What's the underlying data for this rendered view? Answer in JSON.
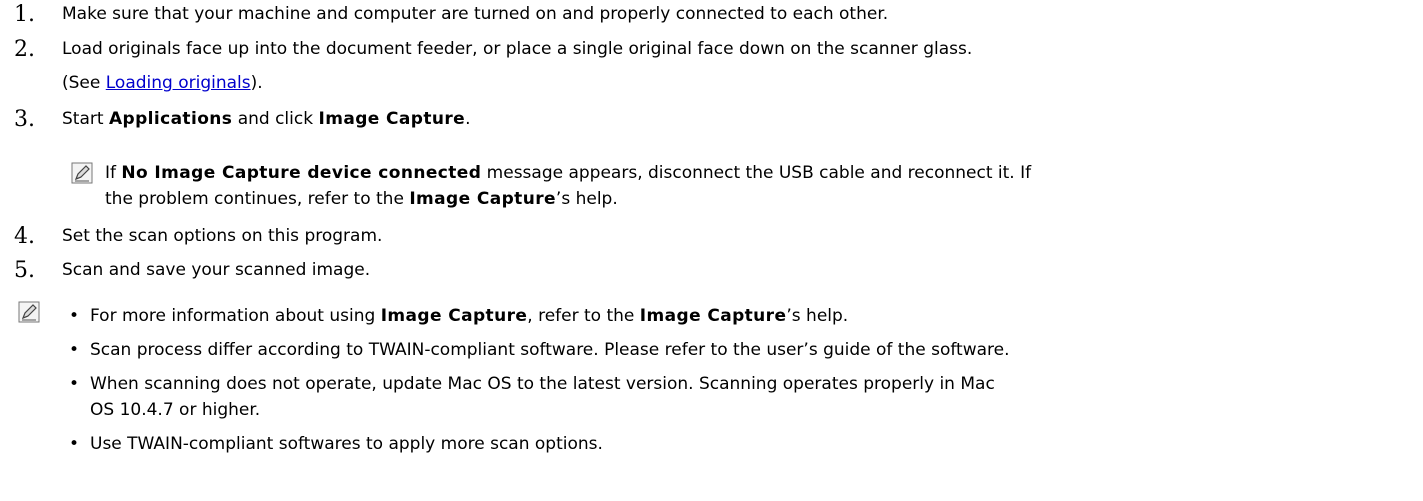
{
  "steps": [
    {
      "number": "1.",
      "text": "Make sure that your machine and computer are turned on and properly connected to each other."
    },
    {
      "number": "2.",
      "text": "Load originals face up into the document feeder, or place a single original face down on the scanner glass.",
      "ref_prefix": "(See ",
      "ref_link": "Loading originals",
      "ref_suffix": ")."
    },
    {
      "number": "3.",
      "text_a": "Start ",
      "bold_a": "Applications",
      "text_b": " and click ",
      "bold_b": "Image Capture",
      "text_c": "."
    },
    {
      "number": "4.",
      "text": "Set the scan options on this program."
    },
    {
      "number": "5.",
      "text": "Scan and save your scanned image."
    }
  ],
  "inline_note": {
    "icon": "note-pencil-icon",
    "text_a": "If ",
    "bold_a": "No Image Capture device connected",
    "text_b": " message appears, disconnect the USB cable and reconnect it. If",
    "line2_a": "the problem continues, refer to the ",
    "bold_b": "Image Capture",
    "line2_b": "’s help."
  },
  "notes": {
    "icon": "note-pencil-icon",
    "bullet_glyph": "•",
    "items": [
      {
        "a": "For more information about using ",
        "b1": "Image Capture",
        "c": ", refer to the ",
        "b2": "Image Capture",
        "d": "’s help."
      },
      {
        "text": "Scan process differ according to TWAIN-compliant software. Please refer to the user’s guide of the software."
      },
      {
        "line1": "When scanning does not operate, update Mac OS to the latest version. Scanning operates properly in Mac",
        "line2": "OS 10.4.7 or higher."
      },
      {
        "text": "Use TWAIN-compliant softwares to apply more scan options."
      }
    ]
  },
  "colors": {
    "link": "#0000cc",
    "text": "#000000",
    "icon": "#5a5a5a"
  }
}
